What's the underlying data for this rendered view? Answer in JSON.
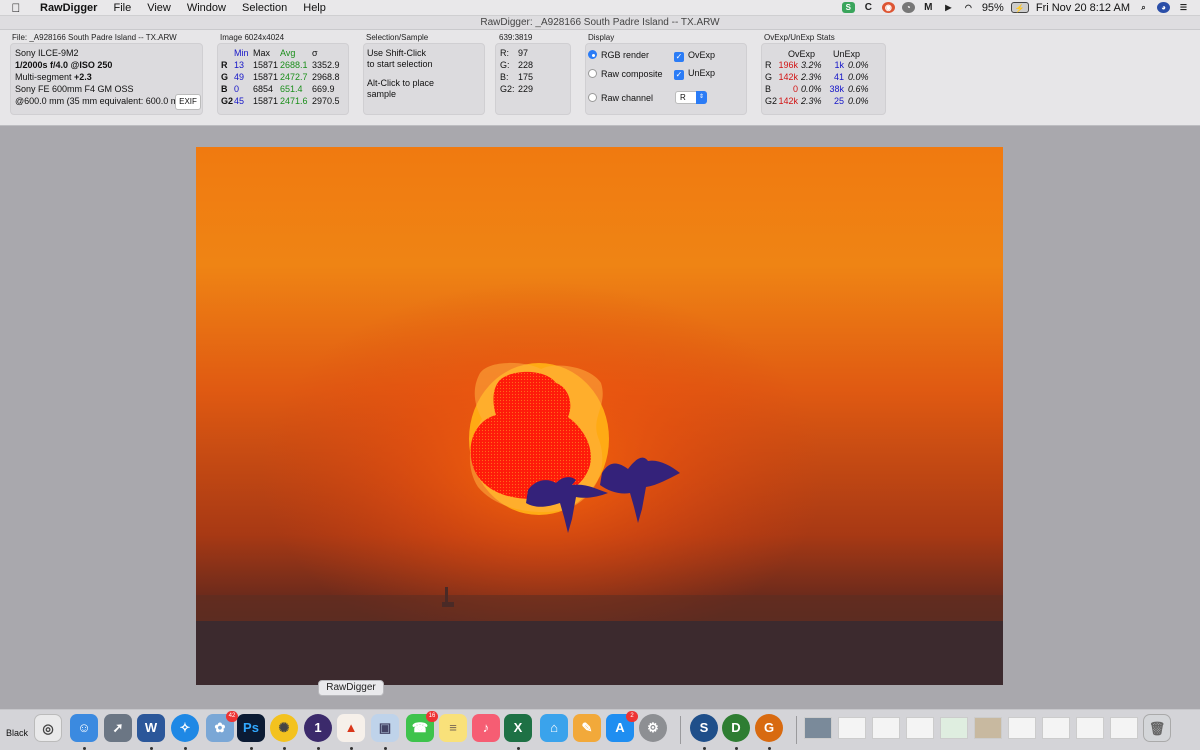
{
  "menubar": {
    "app_name": "RawDigger",
    "menus": [
      "File",
      "View",
      "Window",
      "Selection",
      "Help"
    ],
    "battery": "95%",
    "clock": "Fri Nov 20  8:12 AM"
  },
  "window": {
    "title": "RawDigger: _A928166 South Padre Island -- TX.ARW"
  },
  "file_panel": {
    "label": "File: _A928166 South Padre Island -- TX.ARW",
    "camera": "Sony ILCE-9M2",
    "exposure": "1/2000s f/4.0 @ISO 250",
    "metering_prefix": "Multi-segment",
    "metering_ev": "+2.3",
    "lens": "Sony FE 600mm F4 GM OSS",
    "focal": "@600.0 mm (35 mm equivalent: 600.0 m",
    "exif_button": "EXIF"
  },
  "image_panel": {
    "label": "Image 6024x4024",
    "headers": {
      "min": "Min",
      "max": "Max",
      "avg": "Avg",
      "sigma": "σ"
    },
    "rows": [
      {
        "ch": "R",
        "min": "13",
        "max": "15871",
        "avg": "2688.1",
        "sigma": "3352.9"
      },
      {
        "ch": "G",
        "min": "49",
        "max": "15871",
        "avg": "2472.7",
        "sigma": "2968.8"
      },
      {
        "ch": "B",
        "min": "0",
        "max": "6854",
        "avg": "651.4",
        "sigma": "669.9"
      },
      {
        "ch": "G2",
        "min": "45",
        "max": "15871",
        "avg": "2471.6",
        "sigma": "2970.5"
      }
    ]
  },
  "selection_panel": {
    "label": "Selection/Sample",
    "line1": "Use Shift-Click",
    "line2": "to start selection",
    "line3": "Alt-Click to place",
    "line4": "sample"
  },
  "point_panel": {
    "label": "639:3819",
    "rows": [
      {
        "ch": "R:",
        "val": "97"
      },
      {
        "ch": "G:",
        "val": "228"
      },
      {
        "ch": "B:",
        "val": "175"
      },
      {
        "ch": "G2:",
        "val": "229"
      }
    ]
  },
  "display_panel": {
    "label": "Display",
    "rgb_render": "RGB render",
    "raw_composite": "Raw composite",
    "raw_channel": "Raw channel",
    "ovexp": "OvExp",
    "unexp": "UnExp",
    "channel_value": "R"
  },
  "stats_panel": {
    "label": "OvExp/UnExp Stats",
    "header_ov": "OvExp",
    "header_un": "UnExp",
    "rows": [
      {
        "ch": "R",
        "ov": "196k",
        "ovp": "3.2%",
        "un": "1k",
        "unp": "0.0%"
      },
      {
        "ch": "G",
        "ov": "142k",
        "ovp": "2.3%",
        "un": "41",
        "unp": "0.0%"
      },
      {
        "ch": "B",
        "ov": "0",
        "ovp": "0.0%",
        "un": "38k",
        "unp": "0.6%"
      },
      {
        "ch": "G2",
        "ov": "142k",
        "ovp": "2.3%",
        "un": "25",
        "unp": "0.0%"
      }
    ]
  },
  "dock": {
    "tooltip": "RawDigger",
    "left_label": "Black",
    "badges": {
      "photos": "42",
      "facetime": "16",
      "appstore": "2"
    },
    "icons": {
      "word": "W",
      "photoshop": "Ps",
      "one": "1",
      "excel": "X",
      "s": "S",
      "d": "D",
      "g": "G"
    }
  },
  "colors": {
    "accent": "#2b7cf6",
    "ovexp_overlay": "#ff1a0a",
    "unexp_overlay": "#34227a",
    "stats_red": "#d21414",
    "stats_blue": "#1515c8",
    "avg_green": "#1b8f1b"
  }
}
